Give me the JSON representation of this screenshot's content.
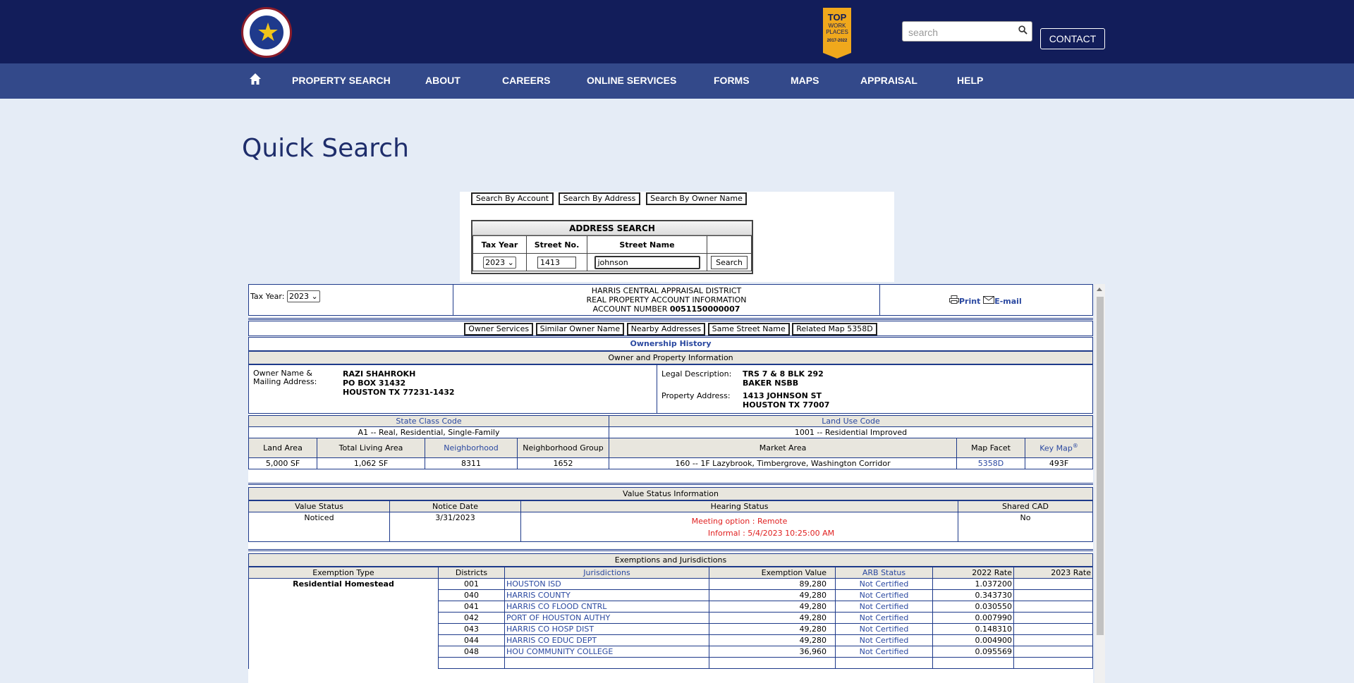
{
  "header": {
    "search_placeholder": "search",
    "contact_label": "CONTACT",
    "badge_top": "TOP",
    "badge_mid": "WORK PLACES",
    "badge_years": "2017-2022"
  },
  "nav": {
    "items": [
      "PROPERTY SEARCH",
      "ABOUT",
      "CAREERS",
      "ONLINE SERVICES",
      "FORMS",
      "MAPS",
      "APPRAISAL",
      "HELP"
    ]
  },
  "page_title": "Quick Search",
  "search": {
    "buttons": [
      "Search By Account",
      "Search By Address",
      "Search By Owner Name"
    ],
    "address_title": "ADDRESS SEARCH",
    "col_tax_year": "Tax Year",
    "col_street_no": "Street No.",
    "col_street_name": "Street Name",
    "tax_year": "2023",
    "street_no": "1413",
    "street_name": "johnson",
    "search_button": "Search"
  },
  "report": {
    "tax_year_label": "Tax Year:",
    "tax_year": "2023",
    "district_line": "HARRIS CENTRAL APPRAISAL DISTRICT",
    "info_line": "REAL PROPERTY ACCOUNT INFORMATION",
    "account_prefix": "ACCOUNT NUMBER",
    "account_number": "0051150000007",
    "print_label": "Print",
    "email_label": "E-mail",
    "buttons": [
      "Owner Services",
      "Similar Owner Name",
      "Nearby Addresses",
      "Same Street Name",
      "Related Map 5358D"
    ],
    "ownership_history": "Ownership History",
    "owner_section": "Owner and Property Information",
    "owner_label_1": "Owner Name &",
    "owner_label_2": "Mailing Address:",
    "owner_name": "RAZI SHAHROKH",
    "owner_addr1": "PO BOX 31432",
    "owner_addr2": "HOUSTON TX 77231-1432",
    "legal_label": "Legal Description:",
    "legal1": "TRS 7 & 8 BLK 292",
    "legal2": "BAKER NSBB",
    "prop_label": "Property Address:",
    "prop1": "1413 JOHNSON ST",
    "prop2": "HOUSTON TX 77007",
    "state_class_label": "State Class Code",
    "state_class": "A1 -- Real, Residential, Single-Family",
    "land_use_label": "Land Use Code",
    "land_use": "1001 -- Residential Improved",
    "land_headers": [
      "Land Area",
      "Total Living Area",
      "Neighborhood",
      "Neighborhood Group",
      "Market Area",
      "Map Facet",
      "Key Map"
    ],
    "land_values": [
      "5,000 SF",
      "1,062 SF",
      "8311",
      "1652",
      "160 -- 1F Lazybrook, Timbergrove, Washington Corridor",
      "5358D",
      "493F"
    ],
    "value_status_title": "Value Status Information",
    "vs_headers": [
      "Value Status",
      "Notice Date",
      "Hearing Status",
      "Shared CAD"
    ],
    "vs_values": [
      "Noticed",
      "3/31/2023",
      "No"
    ],
    "hearing1": "Meeting option : Remote",
    "hearing2": "Informal : 5/4/2023 10:25:00 AM",
    "exemptions_title": "Exemptions and Jurisdictions",
    "ex_headers": [
      "Exemption Type",
      "Districts",
      "Jurisdictions",
      "Exemption Value",
      "ARB Status",
      "2022 Rate",
      "2023 Rate"
    ],
    "exemption_type": "Residential Homestead",
    "rows": [
      [
        "001",
        "HOUSTON ISD",
        "89,280",
        "Not Certified",
        "1.037200"
      ],
      [
        "040",
        "HARRIS COUNTY",
        "49,280",
        "Not Certified",
        "0.343730"
      ],
      [
        "041",
        "HARRIS CO FLOOD CNTRL",
        "49,280",
        "Not Certified",
        "0.030550"
      ],
      [
        "042",
        "PORT OF HOUSTON AUTHY",
        "49,280",
        "Not Certified",
        "0.007990"
      ],
      [
        "043",
        "HARRIS CO HOSP DIST",
        "49,280",
        "Not Certified",
        "0.148310"
      ],
      [
        "044",
        "HARRIS CO EDUC DEPT",
        "49,280",
        "Not Certified",
        "0.004900"
      ],
      [
        "048",
        "HOU COMMUNITY COLLEGE",
        "36,960",
        "Not Certified",
        "0.095569"
      ]
    ]
  }
}
